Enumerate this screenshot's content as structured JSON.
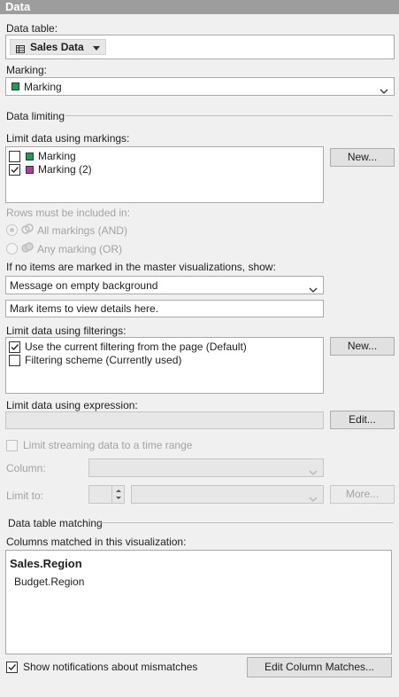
{
  "header": {
    "title": "Data"
  },
  "data_table": {
    "label": "Data table:",
    "value": "Sales Data"
  },
  "marking": {
    "label": "Marking:",
    "value": "Marking",
    "color": "#1aa050"
  },
  "data_limiting": {
    "section_title": "Data limiting"
  },
  "markings": {
    "label": "Limit data using markings:",
    "items": [
      {
        "label": "Marking",
        "checked": false,
        "color": "#1aa050"
      },
      {
        "label": "Marking (2)",
        "checked": true,
        "color": "#b23aa8"
      }
    ],
    "new_label": "New..."
  },
  "rows_included": {
    "label": "Rows must be included in:",
    "option_all": "All markings (AND)",
    "option_any": "Any marking (OR)"
  },
  "empty_master": {
    "label": "If no items are marked in the master visualizations, show:",
    "dropdown_value": "Message on empty background",
    "message_value": "Mark items to view details here."
  },
  "filterings": {
    "label": "Limit data using filterings:",
    "items": [
      {
        "label": "Use the current filtering from the page (Default)",
        "checked": true
      },
      {
        "label": "Filtering scheme (Currently used)",
        "checked": false
      }
    ],
    "new_label": "New..."
  },
  "expression": {
    "label": "Limit data using expression:",
    "value": "",
    "edit_label": "Edit..."
  },
  "streaming": {
    "checkbox_label": "Limit streaming data to a time range",
    "column_label": "Column:",
    "limit_label": "Limit to:",
    "more_label": "More..."
  },
  "table_matching": {
    "section_title": "Data table matching",
    "columns_label": "Columns matched in this visualization:",
    "primary": "Sales.Region",
    "secondary": "Budget.Region",
    "notify_label": "Show notifications about mismatches",
    "notify_checked": true,
    "edit_button": "Edit Column Matches..."
  }
}
